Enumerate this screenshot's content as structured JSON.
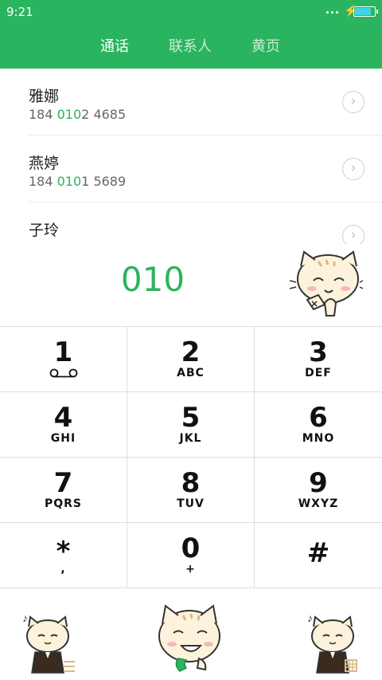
{
  "status_bar": {
    "time": "9:21",
    "battery_level": 0.85
  },
  "tabs": [
    {
      "label": "通话",
      "active": true
    },
    {
      "label": "联系人",
      "active": false
    },
    {
      "label": "黄页",
      "active": false
    }
  ],
  "contacts": [
    {
      "name": "雅娜",
      "number_prefix": "184 ",
      "number_match": "010",
      "number_suffix": "2 4685"
    },
    {
      "name": "燕婷",
      "number_prefix": "184 ",
      "number_match": "010",
      "number_suffix": "1 5689"
    },
    {
      "name": "子玲",
      "number_prefix": "",
      "number_match": "",
      "number_suffix": ""
    }
  ],
  "dial_entry": "010",
  "keypad": [
    {
      "digit": "1",
      "letters": ""
    },
    {
      "digit": "2",
      "letters": "ABC"
    },
    {
      "digit": "3",
      "letters": "DEF"
    },
    {
      "digit": "4",
      "letters": "GHI"
    },
    {
      "digit": "5",
      "letters": "JKL"
    },
    {
      "digit": "6",
      "letters": "MNO"
    },
    {
      "digit": "7",
      "letters": "PQRS"
    },
    {
      "digit": "8",
      "letters": "TUV"
    },
    {
      "digit": "9",
      "letters": "WXYZ"
    },
    {
      "digit": "*",
      "letters": ","
    },
    {
      "digit": "0",
      "letters": "+"
    },
    {
      "digit": "#",
      "letters": ""
    }
  ],
  "colors": {
    "accent": "#2bb45f",
    "battery": "#3fd3e6"
  }
}
